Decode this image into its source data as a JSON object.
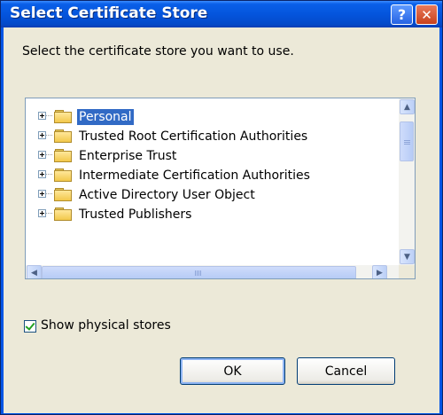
{
  "window": {
    "title": "Select Certificate Store",
    "help_icon": "question-mark",
    "help_glyph": "?",
    "close_icon": "close-x",
    "close_glyph": "✕"
  },
  "prompt": "Select the certificate store you want to use.",
  "tree": {
    "items": [
      {
        "label": "Personal",
        "selected": true
      },
      {
        "label": "Trusted Root Certification Authorities"
      },
      {
        "label": "Enterprise Trust"
      },
      {
        "label": "Intermediate Certification Authorities"
      },
      {
        "label": "Active Directory User Object"
      },
      {
        "label": "Trusted Publishers"
      }
    ],
    "vscroll": {
      "up_glyph": "▲",
      "down_glyph": "▼"
    },
    "hscroll": {
      "left_glyph": "◀",
      "right_glyph": "▶"
    }
  },
  "show_physical": {
    "label": "Show physical stores",
    "checked": true
  },
  "buttons": {
    "ok": "OK",
    "cancel": "Cancel"
  },
  "colors": {
    "titlebar": "#0455dd",
    "selection": "#316ac5",
    "close": "#c8411d",
    "dialog_bg": "#ece9d8"
  }
}
